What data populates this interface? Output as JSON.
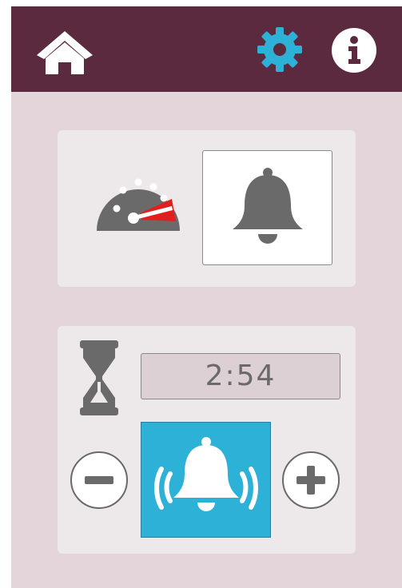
{
  "header": {
    "home_icon": "home-icon",
    "settings_icon": "gear-icon",
    "info_icon": "info-icon",
    "background_color": "#5b2a3f",
    "accent_color": "#2eb1d6"
  },
  "mode_panel": {
    "speed_icon": "speedometer-icon",
    "bell_icon": "bell-icon",
    "selected_mode": "bell"
  },
  "timer_panel": {
    "hourglass_icon": "hourglass-icon",
    "time_value": "2:54",
    "decrease_icon": "minus-icon",
    "increase_icon": "plus-icon",
    "alarm_icon": "ringing-bell-icon",
    "alarm_active": true,
    "alarm_color": "#2eb1d6"
  }
}
